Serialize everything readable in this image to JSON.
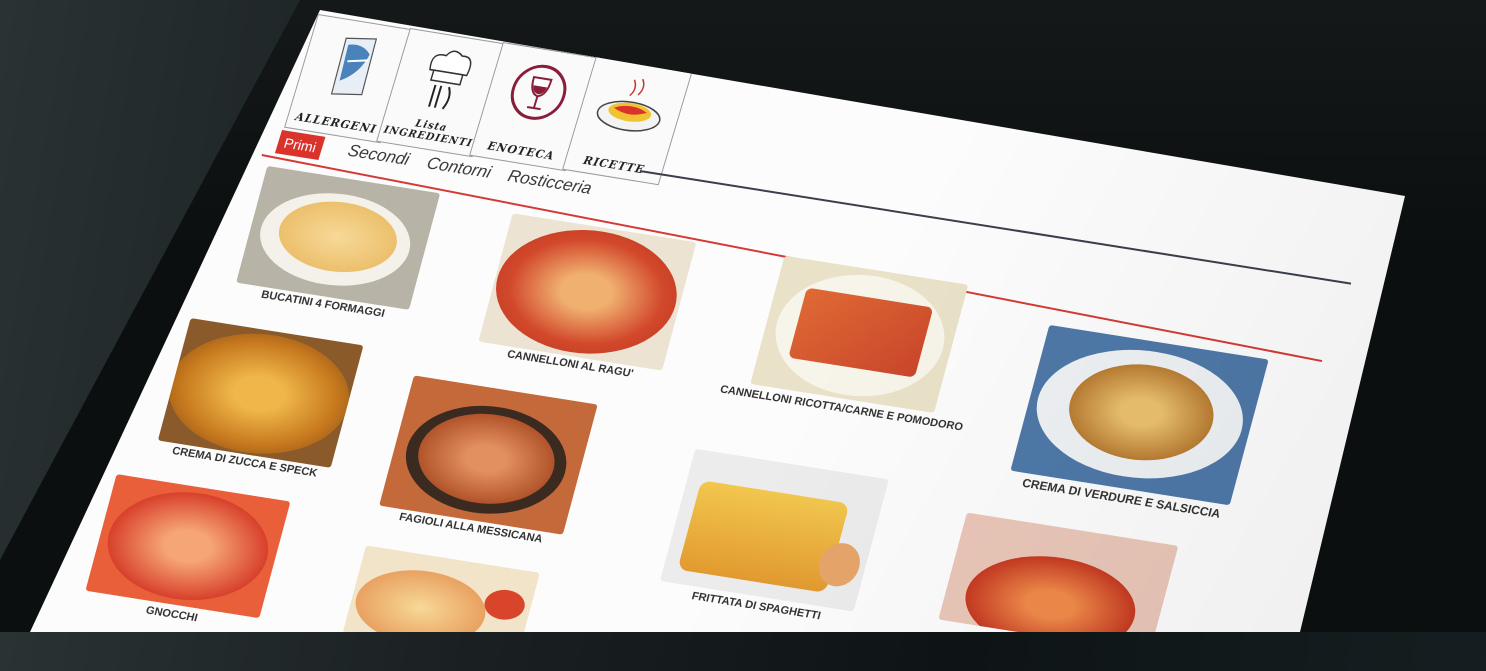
{
  "toolbar": {
    "tiles": [
      {
        "label": "ALLERGENI",
        "icon": "allergens-icon"
      },
      {
        "label": "Lista INGREDIENTI",
        "icon": "chef-hat-icon"
      },
      {
        "label": "ENOTECA",
        "icon": "wine-glass-icon"
      },
      {
        "label": "RICETTE",
        "icon": "pasta-plate-icon"
      }
    ]
  },
  "categories": {
    "tabs": [
      "Primi",
      "Secondi",
      "Contorni",
      "Rosticceria"
    ],
    "active": "Primi"
  },
  "dishes": [
    {
      "name": "BUCATINI 4 FORMAGGI"
    },
    {
      "name": "CANNELLONI AL RAGU'"
    },
    {
      "name": "CANNELLONI RICOTTA/CARNE E POMODORO"
    },
    {
      "name": "CREMA DI ZUCCA E SPECK"
    },
    {
      "name": "FAGIOLI ALLA MESSICANA"
    },
    {
      "name": "CREMA DI VERDURE E SALSICCIA"
    },
    {
      "name": "FRITTATA DI SPAGHETTI"
    },
    {
      "name": "GNOCCHI"
    },
    {
      "name": ""
    },
    {
      "name": ""
    }
  ],
  "colors": {
    "accent": "#d9332b",
    "screen": "#fcfcfc",
    "bezel": "#0b0f10"
  }
}
